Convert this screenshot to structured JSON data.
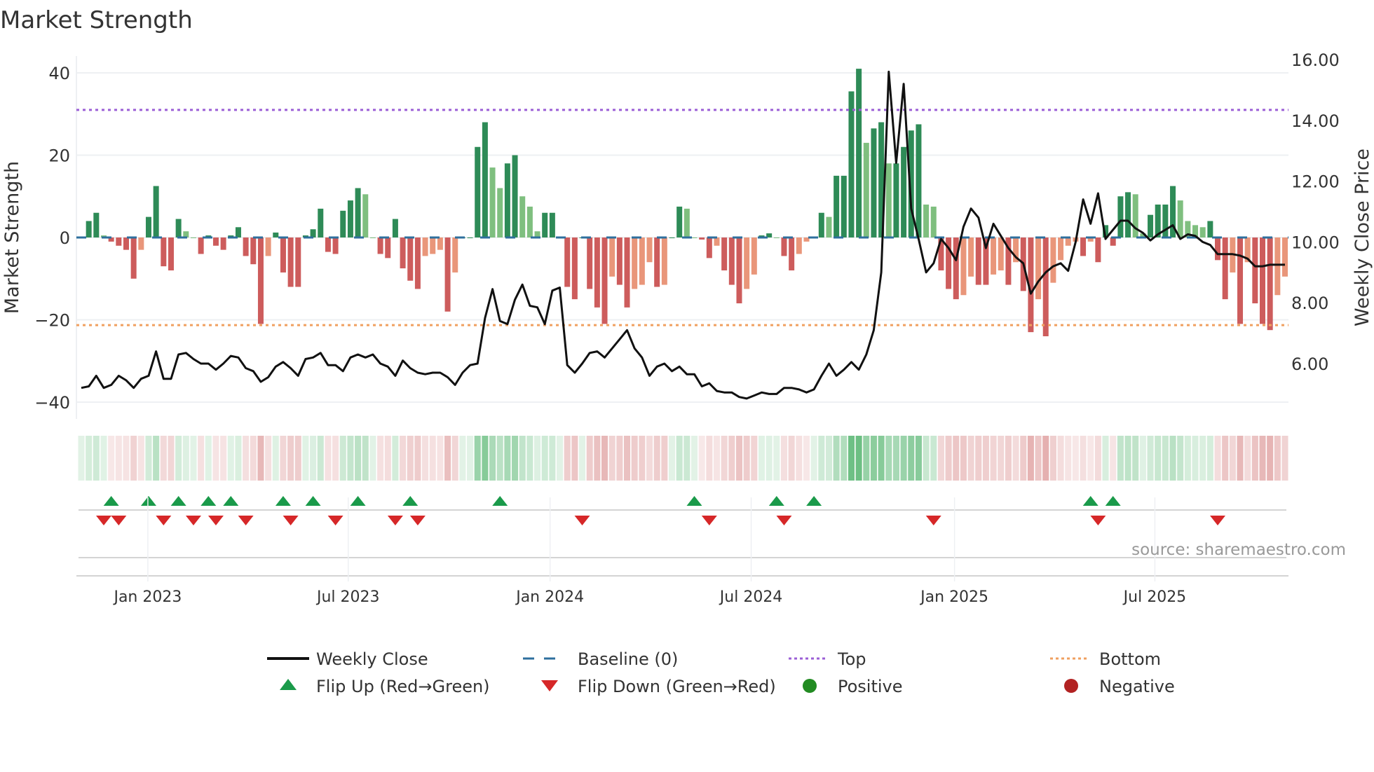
{
  "chart_data": {
    "type": "bar",
    "title": "Market Strength",
    "ylabel": "Market Strength",
    "y2label": "Weekly Close Price",
    "ylim": [
      -44,
      44
    ],
    "y2lim": [
      4.5,
      16.6
    ],
    "yticks": [
      "40",
      "20",
      "0",
      "−20",
      "−40"
    ],
    "ytick_values": [
      40,
      20,
      0,
      -20,
      -40
    ],
    "y2ticks": [
      "16.00",
      "14.00",
      "12.00",
      "10.00",
      "8.00",
      "6.00"
    ],
    "y2tick_values": [
      16,
      14,
      12,
      10,
      8,
      6
    ],
    "xticks": [
      "Jan 2023",
      "Jul 2023",
      "Jan 2024",
      "Jul 2024",
      "Jan 2025",
      "Jul 2025"
    ],
    "xtick_week_index": [
      8.9,
      35.7,
      62.7,
      89.6,
      116.8,
      143.6
    ],
    "top_level": 31,
    "bottom_level": -21.3,
    "baseline": 0,
    "strength": [
      0,
      4,
      6,
      0.5,
      -1,
      -2,
      -3,
      -10,
      -3,
      5,
      12.5,
      -7,
      -8,
      4.5,
      1.5,
      0,
      -4,
      0.5,
      -2,
      -3,
      0.5,
      2.5,
      -4.5,
      -6.5,
      -21,
      -4.5,
      1.2,
      -8.5,
      -12,
      -12,
      0.5,
      2,
      7,
      -3.5,
      -4,
      6.5,
      9,
      12,
      10.5,
      0,
      -4,
      -5,
      4.5,
      -7.5,
      -10.5,
      -12.5,
      -4.5,
      -4,
      -3,
      -18,
      -8.5,
      0,
      0,
      22,
      28,
      17,
      12,
      18,
      20,
      10,
      7.5,
      1.5,
      6,
      6,
      0,
      -12,
      -15,
      0,
      -12.5,
      -17,
      -21,
      -9.5,
      -11.5,
      -17,
      -12.5,
      -11.5,
      -6,
      -12,
      -11.5,
      0,
      7.5,
      7,
      0,
      -0.5,
      -5,
      -2,
      -8,
      -11.5,
      -16,
      -12.5,
      -9,
      0.5,
      1,
      0,
      -4.5,
      -8,
      -4,
      -1,
      0,
      6,
      5,
      15,
      15,
      35.5,
      41,
      23,
      26.5,
      28,
      18,
      18,
      22,
      26,
      27.5,
      8,
      7.5,
      -8,
      -12.5,
      -15,
      -14,
      -9.5,
      -11.5,
      -11.5,
      -9,
      -8,
      -11.5,
      -6,
      -13,
      -23,
      -15,
      -24,
      -11,
      -5.5,
      -2,
      -1,
      -4.5,
      -1,
      -6,
      3,
      -2,
      10,
      11,
      10.5,
      1,
      5.5,
      8,
      8,
      12.5,
      9,
      4,
      3,
      2.5,
      4,
      -5.5,
      -15,
      -8.5,
      -21,
      -6,
      -16,
      -21,
      -22.5,
      -14,
      -9.5
    ],
    "weekly_close": [
      5.2,
      5.25,
      5.6,
      5.2,
      5.3,
      5.6,
      5.45,
      5.2,
      5.5,
      5.6,
      6.4,
      5.5,
      5.5,
      6.3,
      6.35,
      6.15,
      6.0,
      6.0,
      5.8,
      6.0,
      6.25,
      6.2,
      5.85,
      5.75,
      5.4,
      5.55,
      5.9,
      6.05,
      5.85,
      5.6,
      6.15,
      6.2,
      6.35,
      5.95,
      5.95,
      5.75,
      6.2,
      6.3,
      6.2,
      6.3,
      6.0,
      5.9,
      5.6,
      6.1,
      5.85,
      5.7,
      5.65,
      5.7,
      5.7,
      5.55,
      5.3,
      5.7,
      5.95,
      6.0,
      7.5,
      8.45,
      7.4,
      7.3,
      8.1,
      8.6,
      7.9,
      7.85,
      7.3,
      8.4,
      8.5,
      5.95,
      5.7,
      6.0,
      6.35,
      6.4,
      6.2,
      6.5,
      6.8,
      7.1,
      6.5,
      6.2,
      5.6,
      5.9,
      6.0,
      5.75,
      5.9,
      5.65,
      5.65,
      5.25,
      5.35,
      5.1,
      5.05,
      5.05,
      4.9,
      4.85,
      4.95,
      5.05,
      5.0,
      5.0,
      5.2,
      5.2,
      5.15,
      5.05,
      5.15,
      5.6,
      6.0,
      5.6,
      5.8,
      6.05,
      5.8,
      6.3,
      7.1,
      9.0,
      15.6,
      12.6,
      15.2,
      11.1,
      10.1,
      9.0,
      9.3,
      10.1,
      9.8,
      9.4,
      10.5,
      11.1,
      10.8,
      9.8,
      10.6,
      10.2,
      9.8,
      9.5,
      9.3,
      8.3,
      8.7,
      9.0,
      9.2,
      9.3,
      9.05,
      10.0,
      11.4,
      10.6,
      11.6,
      10.1,
      10.4,
      10.7,
      10.7,
      10.45,
      10.3,
      10.05,
      10.25,
      10.4,
      10.55,
      10.1,
      10.25,
      10.2,
      10.0,
      9.9,
      9.6,
      9.6,
      9.6,
      9.55,
      9.45,
      9.2,
      9.2,
      9.25,
      9.25,
      9.25
    ],
    "flip_up_weeks": [
      4,
      9,
      13,
      17,
      20,
      27,
      31,
      37,
      44,
      56,
      82,
      93,
      98,
      135,
      138
    ],
    "flip_down_weeks": [
      3,
      5,
      11,
      15,
      18,
      22,
      28,
      34,
      42,
      45,
      67,
      84,
      94,
      114,
      136,
      152
    ],
    "legend": [
      {
        "label": "Weekly Close",
        "kind": "line",
        "color": "#111111"
      },
      {
        "label": "Baseline (0)",
        "kind": "dash",
        "color": "#2e6f9e"
      },
      {
        "label": "Top",
        "kind": "dot",
        "color": "#9b5fd6"
      },
      {
        "label": "Bottom",
        "kind": "dot",
        "color": "#f0a060"
      },
      {
        "label": "Flip Up (Red→Green)",
        "kind": "up",
        "color": "#1a9a4a"
      },
      {
        "label": "Flip Down (Green→Red)",
        "kind": "down",
        "color": "#d62728"
      },
      {
        "label": "Positive",
        "kind": "circle",
        "color": "#228b22"
      },
      {
        "label": "Negative",
        "kind": "circle",
        "color": "#b22222"
      }
    ],
    "legend_placement": "bottom",
    "colors": {
      "pos_strong": "#2e8b57",
      "pos_weak": "#7fbf7f",
      "neg_strong": "#cd5c5c",
      "neg_weak": "#e9967a"
    }
  },
  "source": "source: sharemaestro.com"
}
